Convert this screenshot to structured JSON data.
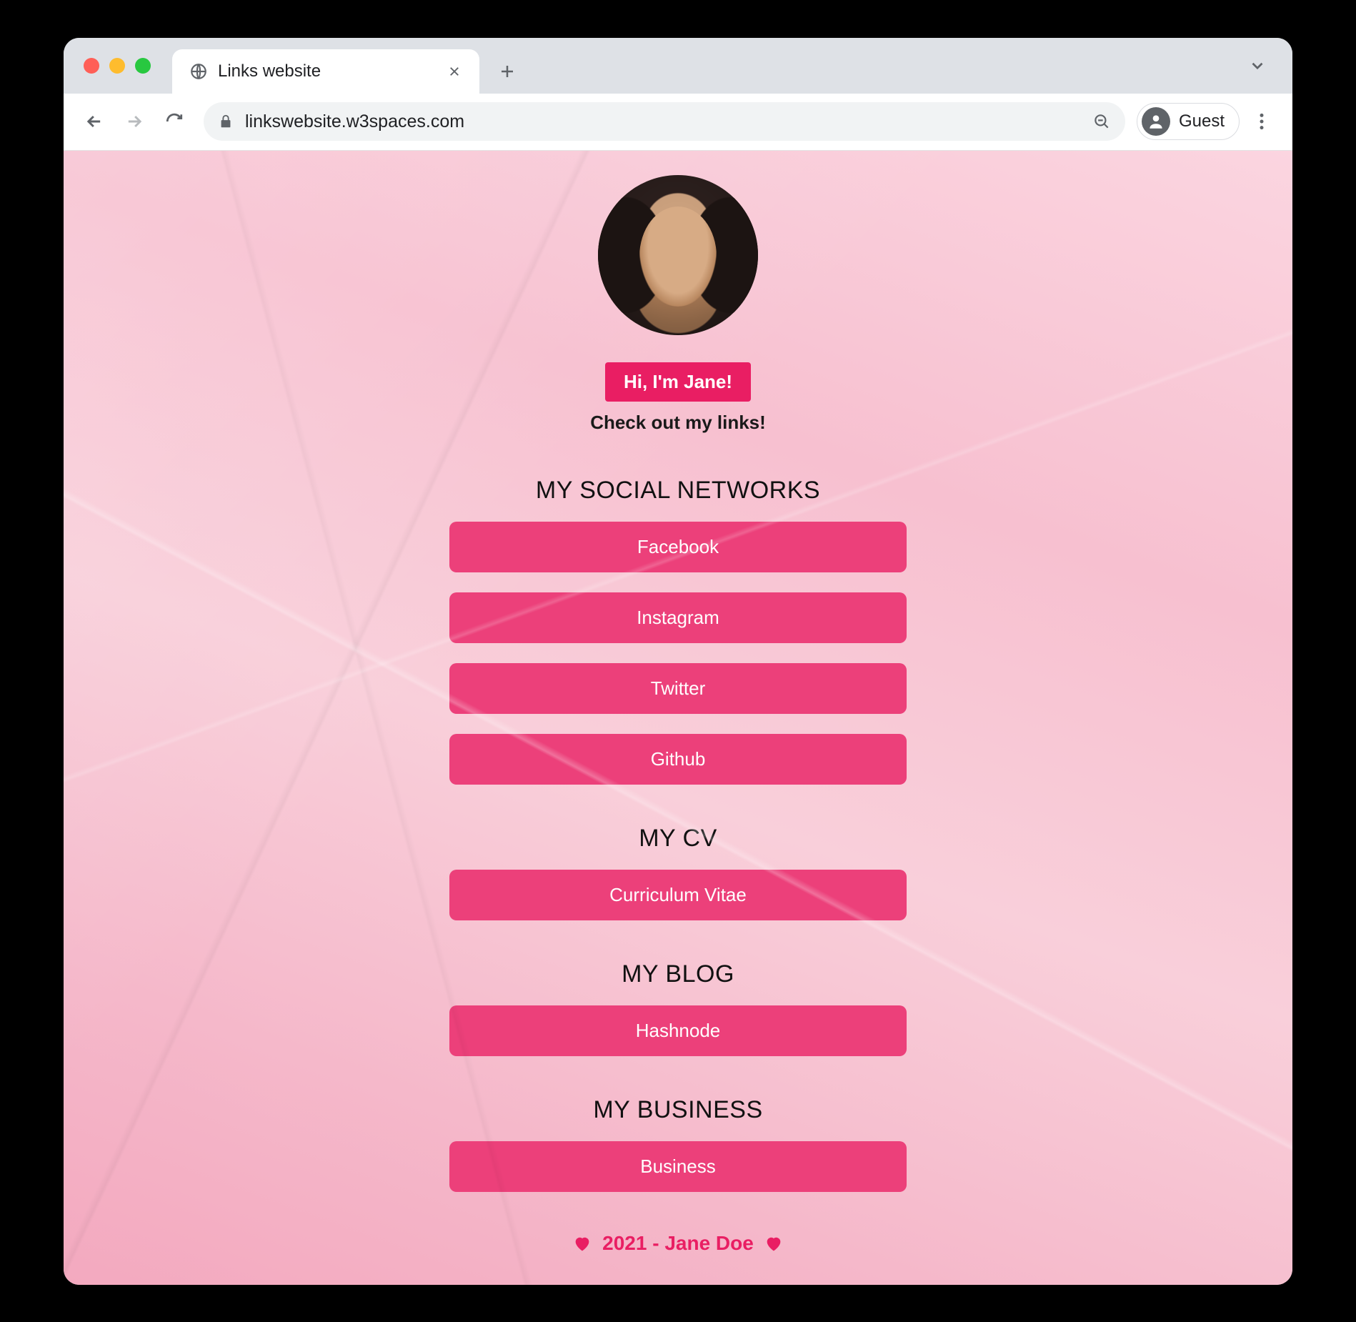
{
  "browser": {
    "tab_title": "Links website",
    "url": "linkswebsite.w3spaces.com",
    "guest_label": "Guest"
  },
  "header": {
    "greeting": "Hi, I'm Jane!",
    "subtitle": "Check out my links!"
  },
  "sections": {
    "social": {
      "title": "MY SOCIAL NETWORKS",
      "links": [
        "Facebook",
        "Instagram",
        "Twitter",
        "Github"
      ]
    },
    "cv": {
      "title": "MY CV",
      "links": [
        "Curriculum Vitae"
      ]
    },
    "blog": {
      "title": "MY BLOG",
      "links": [
        "Hashnode"
      ]
    },
    "business": {
      "title": "MY BUSINESS",
      "links": [
        "Business"
      ]
    }
  },
  "footer": {
    "text": "2021 - Jane Doe"
  }
}
